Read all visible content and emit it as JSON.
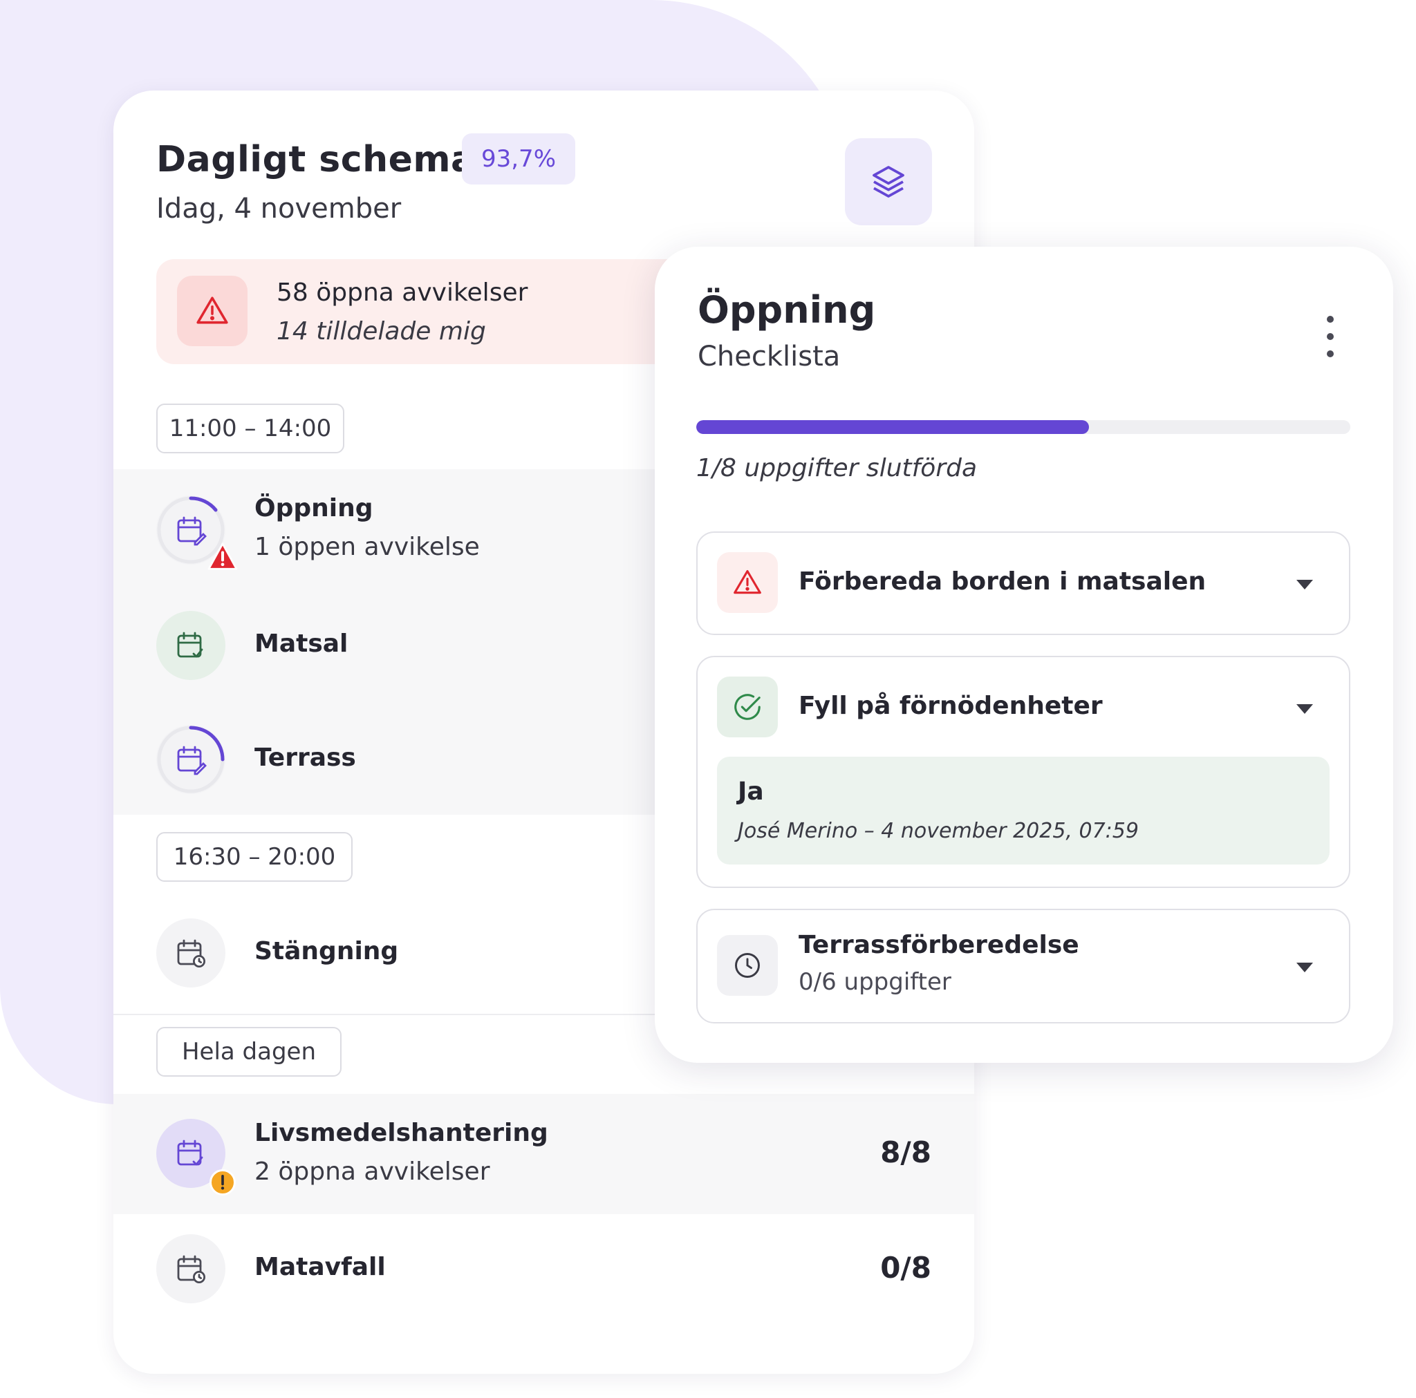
{
  "schedule": {
    "title": "Dagligt schema",
    "completion_badge": "93,7%",
    "date": "Idag, 4 november",
    "layers_icon": "layers-icon",
    "alert": {
      "icon": "warning-triangle-icon",
      "title": "58 öppna avvikelser",
      "subtitle": "14 tilldelade mig"
    },
    "groups": [
      {
        "time": "11:00 – 14:00",
        "items": [
          {
            "title": "Öppning",
            "subtitle": "1 öppen avvikelse",
            "icon": "calendar-edit-icon",
            "badge": "error-triangle-icon"
          },
          {
            "title": "Matsal",
            "subtitle": "",
            "icon": "calendar-check-icon"
          },
          {
            "title": "Terrass",
            "subtitle": "",
            "icon": "calendar-edit-icon"
          }
        ]
      },
      {
        "time": "16:30 – 20:00",
        "items": [
          {
            "title": "Stängning",
            "subtitle": "",
            "icon": "calendar-clock-icon"
          }
        ]
      },
      {
        "time": "Hela dagen",
        "items": [
          {
            "title": "Livsmedelshantering",
            "subtitle": "2 öppna avvikelser",
            "count": "8/8",
            "icon": "calendar-check-icon",
            "badge": "warning-circle-icon"
          },
          {
            "title": "Matavfall",
            "subtitle": "",
            "count": "0/8",
            "icon": "calendar-clock-icon"
          }
        ]
      }
    ]
  },
  "checklist": {
    "title": "Öppning",
    "subtitle": "Checklista",
    "progress_fraction": 0.6,
    "progress_text": "1/8 uppgifter slutförda",
    "tasks": [
      {
        "title": "Förbereda borden i matsalen",
        "icon": "warning-triangle-icon",
        "status": "deviation"
      },
      {
        "title": "Fyll på förnödenheter",
        "icon": "check-circle-icon",
        "status": "done",
        "answer": {
          "value": "Ja",
          "meta": "José Merino – 4 november 2025, 07:59"
        }
      },
      {
        "title": "Terrassförberedelse",
        "subtitle": "0/6 uppgifter",
        "icon": "clock-icon",
        "status": "pending"
      }
    ]
  },
  "colors": {
    "accent": "#6446d4",
    "danger": "#e0262f",
    "warning": "#f5a623",
    "success": "#2f8a4a",
    "background_blob": "#f0ecfc"
  }
}
